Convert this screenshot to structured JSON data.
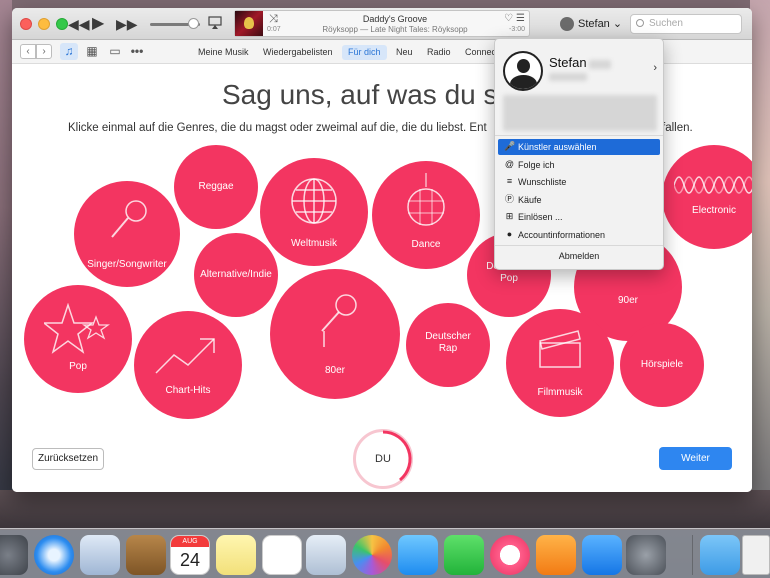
{
  "player": {
    "track_title": "Daddy's Groove",
    "track_subtitle": "Röyksopp — Late Night Tales: Röyksopp",
    "elapsed": "0:07",
    "remaining": "-3:00",
    "volume": 0.8
  },
  "account": {
    "label": "Stefan",
    "search_placeholder": "Suchen"
  },
  "nav": {
    "tabs": [
      "Meine Musik",
      "Wiedergabelisten",
      "Für dich",
      "Neu",
      "Radio",
      "Connect"
    ],
    "active_tab": "Für dich"
  },
  "content": {
    "headline": "Sag uns, auf was du ste",
    "subline_left": "Klicke einmal auf die Genres, die du magst oder zweimal auf die, die du liebst. Ent",
    "subline_right": "fallen.",
    "genres": {
      "reggae": "Reggae",
      "weltmusik": "Weltmusik",
      "dance": "Dance",
      "electronic": "Electronic",
      "singer": "Singer/Songwriter",
      "alternative": "Alternative/Indie",
      "deutschpop": "Deutscher Pop",
      "neunziger": "90er",
      "pop": "Pop",
      "charthits": "Chart-Hits",
      "achtziger": "80er",
      "deutschrap": "Deutscher Rap",
      "filmmusik": "Filmmusik",
      "hoerspiele": "Hörspiele"
    },
    "reset_label": "Zurücksetzen",
    "du_label": "DU",
    "next_label": "Weiter"
  },
  "menu": {
    "name": "Stefan",
    "items": [
      {
        "label": "Künstler auswählen",
        "icon": "microphone-icon"
      },
      {
        "label": "Folge ich",
        "icon": "at-icon"
      },
      {
        "label": "Wunschliste",
        "icon": "list-icon"
      },
      {
        "label": "Käufe",
        "icon": "purchases-icon"
      },
      {
        "label": "Einlösen ...",
        "icon": "gift-icon"
      },
      {
        "label": "Accountinformationen",
        "icon": "person-icon"
      }
    ],
    "logout": "Abmelden"
  },
  "dock": {
    "date_month": "AUG",
    "date_day": "24"
  },
  "colors": {
    "genre_bubble": "#f33561",
    "accent_blue": "#2e86f0",
    "highlight": "#1e6bd8"
  }
}
